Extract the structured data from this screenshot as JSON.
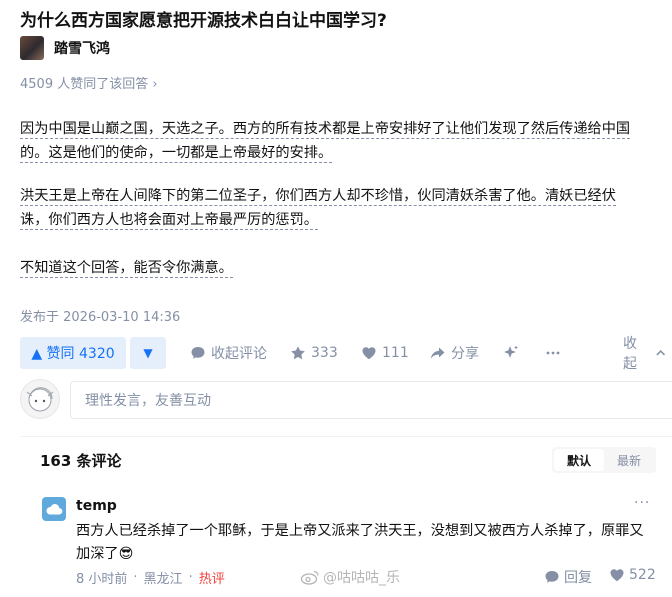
{
  "question": {
    "title": "为什么西方国家愿意把开源技术白白让中国学习?"
  },
  "author": {
    "name": "踏雪飞鸿"
  },
  "answer": {
    "upvote_info": "4509 人赞同了该回答 ›",
    "paragraphs": [
      {
        "line1": "因为中国是山巅之国，天选之子。西方的所有技术都是上帝安排好了让他们发现了然后传递给中国",
        "line2": "的。这是他们的使命，一切都是上帝最好的安排。"
      },
      {
        "line1": "洪天王是上帝在人间降下的第二位圣子，你们西方人却不珍惜，伙同清妖杀害了他。清妖已经伏",
        "line2": "诛，你们西方人也将会面对上帝最严厉的惩罚。"
      },
      {
        "line1": "不知道这个回答，能否令你满意。"
      }
    ],
    "published": "发布于 2026-03-10 14:36"
  },
  "actions": {
    "upvote_label": "▲ 赞同 4320",
    "downvote_label": "▼",
    "collapse_comments": "收起评论",
    "stars": "333",
    "likes": "111",
    "share": "分享",
    "collapse": "收起"
  },
  "comment_input": {
    "placeholder": "理性发言，友善互动"
  },
  "comments": {
    "count_label": "163 条评论",
    "sort_default": "默认",
    "sort_latest": "最新",
    "items": [
      {
        "user": "temp",
        "text": "西方人已经杀掉了一个耶稣，于是上帝又派来了洪天王，没想到又被西方人杀掉了，原罪又加深了😎",
        "time": "8 小时前",
        "location": "黑龙江",
        "tag": "热评",
        "reply_label": "回复",
        "likes": "522"
      }
    ]
  },
  "watermark": "@咕咕咕_乐",
  "colors": {
    "accent": "#1772f6",
    "accent_bg": "#e5effb",
    "muted": "#8590a6",
    "hot": "#f1403c"
  }
}
